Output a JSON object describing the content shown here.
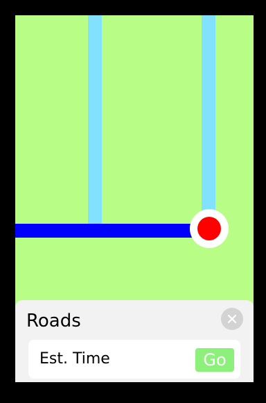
{
  "map": {
    "background_color": "#b8fd85",
    "road_color": "#82e1ff",
    "route_color": "#0000ff",
    "pin_color": "#ff0000"
  },
  "sheet": {
    "title": "Roads",
    "close_icon": "close-icon",
    "option": {
      "label": "Est. Time",
      "go_label": "Go",
      "go_color": "#8cf07a"
    }
  }
}
